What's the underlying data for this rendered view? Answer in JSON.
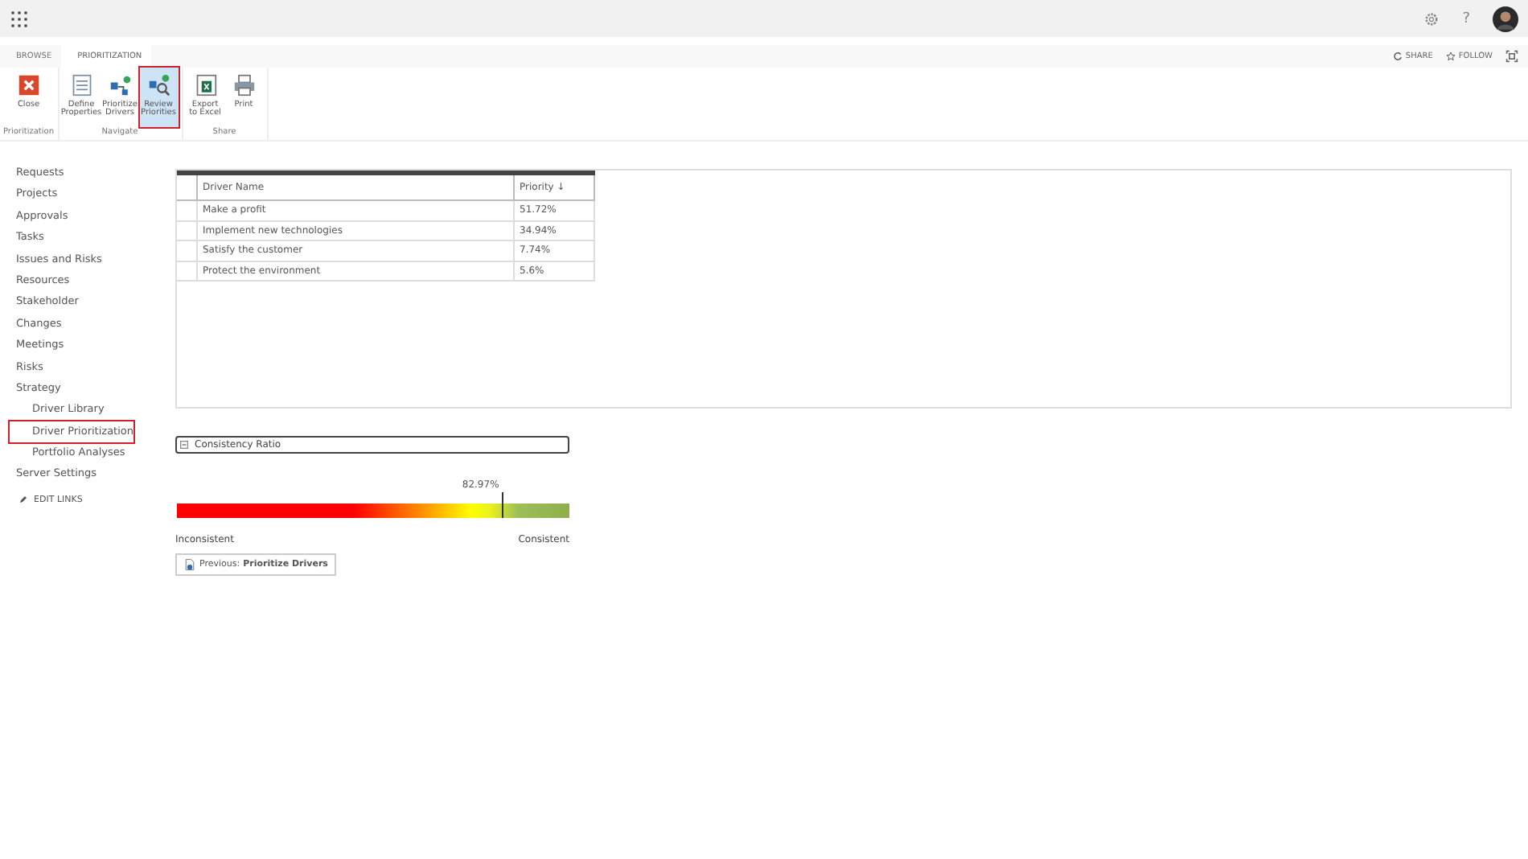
{
  "suite_bar": {
    "help": "?"
  },
  "ribbon_tabs": [
    {
      "label": "BROWSE",
      "selected": false
    },
    {
      "label": "PRIORITIZATION",
      "selected": true
    }
  ],
  "actions": [
    {
      "label": "SHARE",
      "kind": "share"
    },
    {
      "label": "FOLLOW",
      "kind": "follow"
    }
  ],
  "ribbon_groups": [
    {
      "label": "Prioritization",
      "buttons": [
        {
          "label": "Close",
          "kind": "close",
          "selected": false
        }
      ]
    },
    {
      "label": "Navigate",
      "buttons": [
        {
          "label": "Define Properties",
          "kind": "define",
          "selected": false
        },
        {
          "label": "Prioritize Drivers",
          "kind": "prioritize",
          "selected": false
        },
        {
          "label": "Review Priorities",
          "kind": "review",
          "selected": true
        }
      ]
    },
    {
      "label": "Share",
      "buttons": [
        {
          "label": "Export to Excel",
          "kind": "excel",
          "selected": false
        },
        {
          "label": "Print",
          "kind": "print",
          "selected": false
        }
      ]
    }
  ],
  "nav": [
    {
      "label": "Requests",
      "selected": false
    },
    {
      "label": "Projects",
      "selected": false
    },
    {
      "label": "Approvals",
      "selected": false
    },
    {
      "label": "Tasks",
      "selected": false
    },
    {
      "label": "Issues and Risks",
      "selected": false
    },
    {
      "label": "Resources",
      "selected": false
    },
    {
      "label": "Stakeholder",
      "selected": false
    },
    {
      "label": "Changes",
      "selected": false
    },
    {
      "label": "Meetings",
      "selected": false
    },
    {
      "label": "Risks",
      "selected": false
    },
    {
      "label": "Strategy",
      "selected": false,
      "children": [
        {
          "label": "Driver Library",
          "selected": false
        },
        {
          "label": "Driver Prioritization",
          "selected": true
        },
        {
          "label": "Portfolio Analyses",
          "selected": false
        }
      ]
    },
    {
      "label": "Server Settings",
      "selected": false
    }
  ],
  "edit_links": "EDIT LINKS",
  "table": {
    "columns": [
      "Driver Name",
      "Priority ↓"
    ],
    "rows": [
      [
        "Make a profit",
        "51.72%"
      ],
      [
        "Implement new technologies",
        "34.94%"
      ],
      [
        "Satisfy the customer",
        "7.74%"
      ],
      [
        "Protect the environment",
        "5.6%"
      ]
    ]
  },
  "consistency": {
    "title": "Consistency Ratio",
    "reading": "82.97%",
    "level": 0.8297,
    "low_label": "Inconsistent",
    "high_label": "Consistent"
  },
  "previous_button": {
    "prefix": "Previous: ",
    "target": "Prioritize Drivers"
  }
}
